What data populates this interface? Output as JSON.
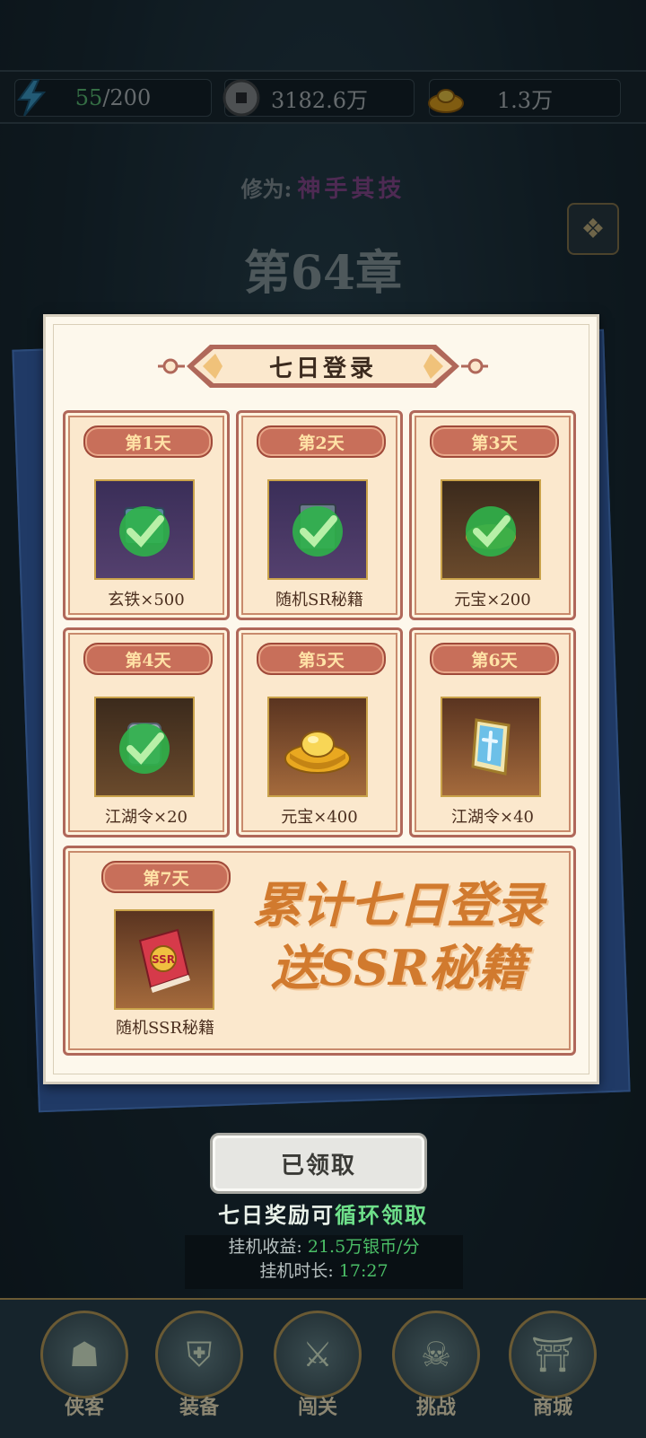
{
  "resources": {
    "energy_current": "55",
    "energy_max": "/200",
    "coins": "3182.6万",
    "gold": "1.3万"
  },
  "realm": {
    "label": "修为:",
    "value": "神手其技"
  },
  "chapter": {
    "title": "第64章"
  },
  "modal": {
    "title": "七日登录",
    "days": [
      {
        "tag": "第1天",
        "item": "玄铁×500",
        "claimed": true
      },
      {
        "tag": "第2天",
        "item": "随机SR秘籍",
        "claimed": true
      },
      {
        "tag": "第3天",
        "item": "元宝×200",
        "claimed": true
      },
      {
        "tag": "第4天",
        "item": "江湖令×20",
        "claimed": true
      },
      {
        "tag": "第5天",
        "item": "元宝×400",
        "claimed": false
      },
      {
        "tag": "第6天",
        "item": "江湖令×40",
        "claimed": false
      }
    ],
    "day7": {
      "tag": "第7天",
      "item": "随机SSR秘籍",
      "book_label": "SSR"
    },
    "slogan_line1": "累计七日登录",
    "slogan_line2": "送SSR秘籍"
  },
  "claim_button": "已领取",
  "hint": {
    "prefix": "七日奖励可",
    "highlight": "循环领取"
  },
  "idle": {
    "income_label": "挂机收益:",
    "income_value": "21.5万银币/分",
    "duration_label": "挂机时长:",
    "duration_value": "17:27"
  },
  "nav": [
    {
      "label": "侠客",
      "icon": "hero-icon"
    },
    {
      "label": "装备",
      "icon": "armor-icon"
    },
    {
      "label": "闯关",
      "icon": "sword-icon"
    },
    {
      "label": "挑战",
      "icon": "demon-icon"
    },
    {
      "label": "商城",
      "icon": "shop-icon"
    }
  ],
  "colors": {
    "accent_green": "#6ee08a",
    "tag_red": "#c86f5a",
    "slogan_orange": "#d17a2e"
  }
}
